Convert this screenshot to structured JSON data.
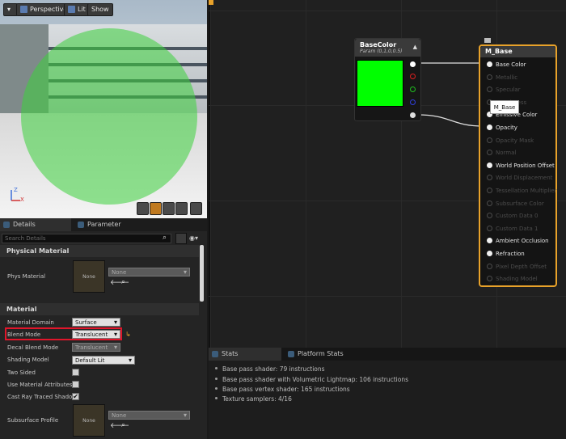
{
  "viewport": {
    "perspective_label": "Perspective",
    "lit_label": "Lit",
    "show_label": "Show",
    "axis_z": "Z",
    "axis_x": "X"
  },
  "details": {
    "tabs": [
      {
        "label": "Details"
      },
      {
        "label": "Parameter Defaults"
      }
    ],
    "search_placeholder": "Search Details",
    "sections": {
      "physical_material": "Physical Material",
      "material": "Material"
    },
    "props": {
      "phys_material": {
        "label": "Phys Material",
        "thumb": "None",
        "value": "None"
      },
      "material_domain": {
        "label": "Material Domain",
        "value": "Surface"
      },
      "blend_mode": {
        "label": "Blend Mode",
        "value": "Translucent"
      },
      "decal_blend_mode": {
        "label": "Decal Blend Mode",
        "value": "Translucent"
      },
      "shading_model": {
        "label": "Shading Model",
        "value": "Default Lit"
      },
      "two_sided": {
        "label": "Two Sided",
        "checked": false
      },
      "use_material_attributes": {
        "label": "Use Material Attributes",
        "checked": false
      },
      "cast_ray_traced_shadow": {
        "label": "Cast Ray Traced Shadow",
        "checked": true,
        "mark": "✔"
      },
      "subsurface_profile": {
        "label": "Subsurface Profile",
        "thumb": "None",
        "value": "None"
      }
    }
  },
  "graph": {
    "param_node": {
      "title": "BaseColor",
      "subtitle": "Param (0,1,0,0.5)",
      "swatch": "#00ff00"
    },
    "m_node": {
      "title": "M_Base",
      "pins": [
        {
          "label": "Base Color",
          "active": true
        },
        {
          "label": "Metallic",
          "active": false
        },
        {
          "label": "Specular",
          "active": false
        },
        {
          "label": "Roughness",
          "active": false
        },
        {
          "label": "Emissive Color",
          "active": true
        },
        {
          "label": "Opacity",
          "active": true
        },
        {
          "label": "Opacity Mask",
          "active": false
        },
        {
          "label": "Normal",
          "active": false
        },
        {
          "label": "World Position Offset",
          "active": true
        },
        {
          "label": "World Displacement",
          "active": false
        },
        {
          "label": "Tessellation Multiplier",
          "active": false
        },
        {
          "label": "Subsurface Color",
          "active": false
        },
        {
          "label": "Custom Data 0",
          "active": false
        },
        {
          "label": "Custom Data 1",
          "active": false
        },
        {
          "label": "Ambient Occlusion",
          "active": true
        },
        {
          "label": "Refraction",
          "active": true
        },
        {
          "label": "Pixel Depth Offset",
          "active": false
        },
        {
          "label": "Shading Model",
          "active": false
        }
      ]
    },
    "tooltip": "M_Base"
  },
  "stats": {
    "tabs": [
      {
        "label": "Stats"
      },
      {
        "label": "Platform Stats"
      }
    ],
    "lines": [
      "Base pass shader: 79 instructions",
      "Base pass shader with Volumetric Lightmap: 106 instructions",
      "Base pass vertex shader: 165 instructions",
      "Texture samplers: 4/16"
    ]
  },
  "colors": {
    "accent_orange": "#e8a22a",
    "highlight_red": "#e0162b",
    "green_param": "#00ff00"
  }
}
